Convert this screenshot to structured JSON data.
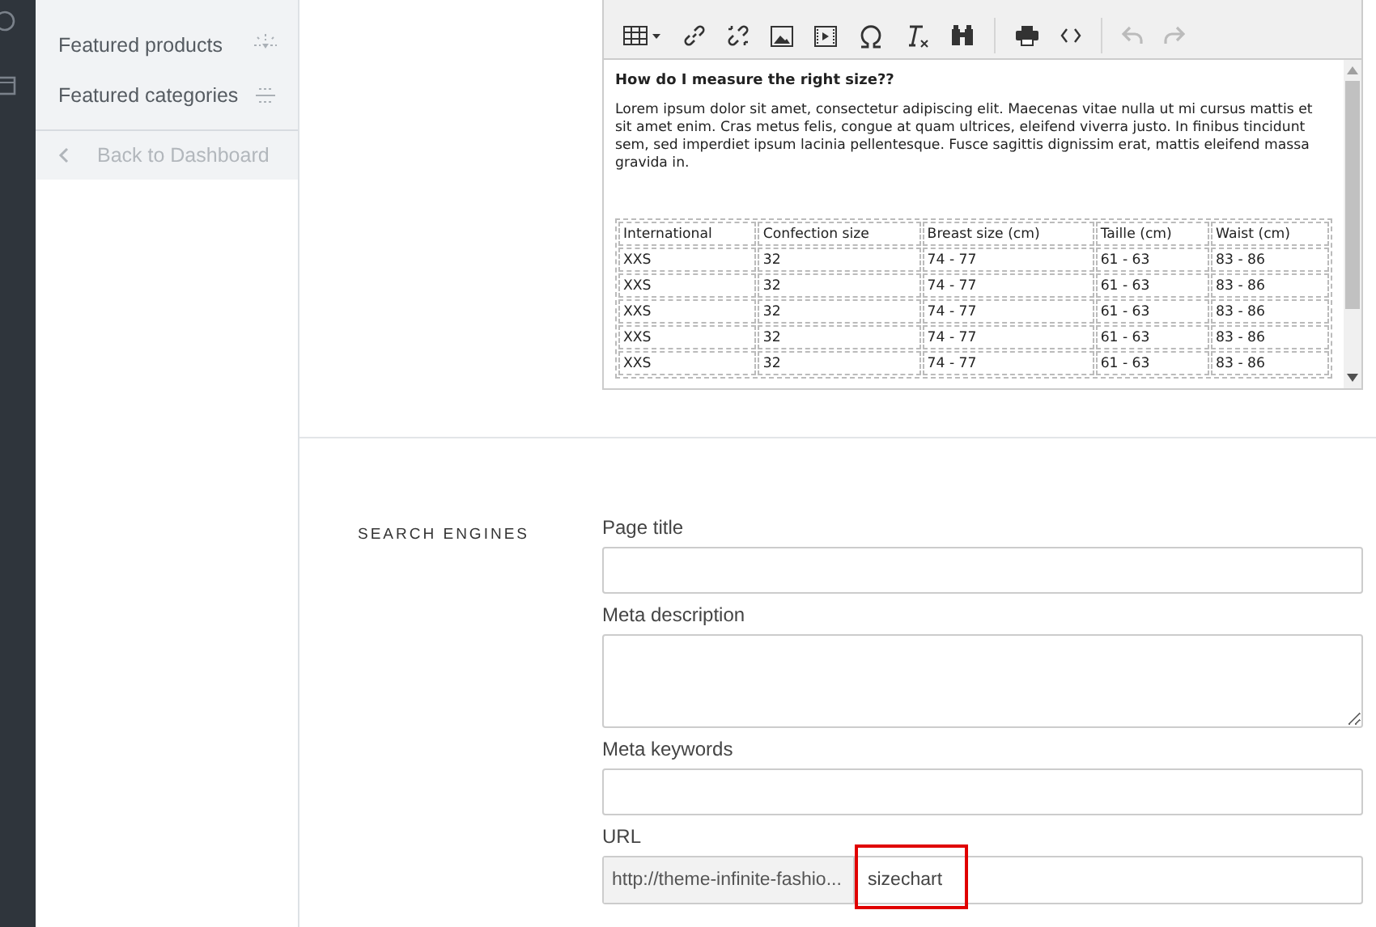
{
  "sidebar": {
    "items": [
      {
        "label": "Featured products"
      },
      {
        "label": "Featured categories"
      }
    ],
    "back_link": "Back to Dashboard"
  },
  "editor": {
    "heading": "How do I measure the right size??",
    "paragraph": "Lorem ipsum dolor sit amet, consectetur adipiscing elit. Maecenas vitae nulla ut mi cursus mattis et sit amet enim. Cras metus felis, congue at quam ultrices, eleifend viverra justo. In finibus tincidunt sem, sed imperdiet ipsum lacinia pellentesque. Fusce sagittis dignissim erat, mattis eleifend massa gravida in.",
    "table": {
      "columns": [
        "International",
        "Confection size",
        "Breast size (cm)",
        "Taille (cm)",
        "Waist (cm)"
      ],
      "rows": [
        [
          "XXS",
          "32",
          "74 - 77",
          "61 - 63",
          "83 - 86"
        ],
        [
          "XXS",
          "32",
          "74 - 77",
          "61 - 63",
          "83 - 86"
        ],
        [
          "XXS",
          "32",
          "74 - 77",
          "61 - 63",
          "83 - 86"
        ],
        [
          "XXS",
          "32",
          "74 - 77",
          "61 - 63",
          "83 - 86"
        ],
        [
          "XXS",
          "32",
          "74 - 77",
          "61 - 63",
          "83 - 86"
        ]
      ]
    }
  },
  "seo": {
    "title": "SEARCH ENGINES",
    "fields": [
      {
        "label": "Page title",
        "kind": "input"
      },
      {
        "label": "Meta description",
        "kind": "textarea"
      },
      {
        "label": "Meta keywords",
        "kind": "input"
      }
    ],
    "url": {
      "label": "URL",
      "prefix": "http://theme-infinite-fashio...",
      "value": "sizechart",
      "highlighted": true
    }
  }
}
